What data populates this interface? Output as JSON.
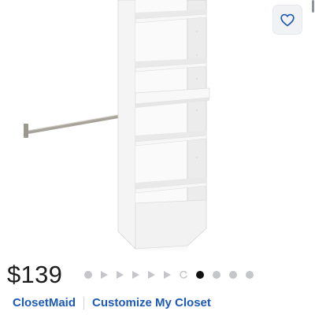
{
  "product": {
    "price": "$139",
    "brand": "ClosetMaid",
    "collection": "Customize My Closet",
    "favorite_icon": "heart-outline-icon"
  },
  "carousel": {
    "items": [
      "dot",
      "arrow",
      "arrow",
      "arrow",
      "arrow",
      "arrow",
      "spin-360",
      "dot-active",
      "dot",
      "dot",
      "dot"
    ],
    "active_index": 7
  },
  "colors": {
    "link": "#1c5ab4",
    "price": "#1d1d1f",
    "dot_inactive": "#c4c6c9",
    "dot_active": "#111111"
  }
}
